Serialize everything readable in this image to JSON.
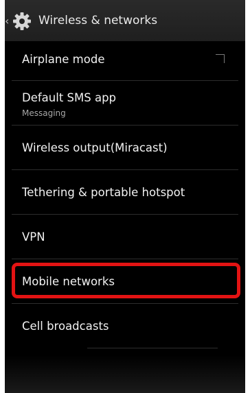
{
  "header": {
    "title": "Wireless & networks",
    "back_icon": "chevron-left-icon",
    "settings_icon": "gear-icon"
  },
  "settings": [
    {
      "label": "Airplane mode",
      "has_checkbox": true,
      "checked": false
    },
    {
      "label": "Default SMS app",
      "sub": "Messaging"
    },
    {
      "label": "Wireless output(Miracast)"
    },
    {
      "label": "Tethering & portable hotspot"
    },
    {
      "label": "VPN"
    },
    {
      "label": "Mobile networks",
      "highlighted": true
    },
    {
      "label": "Cell broadcasts"
    }
  ],
  "colors": {
    "background": "#000000",
    "highlight": "#e31313",
    "text": "#f2f2f2",
    "subtext": "#a7a7a7"
  }
}
